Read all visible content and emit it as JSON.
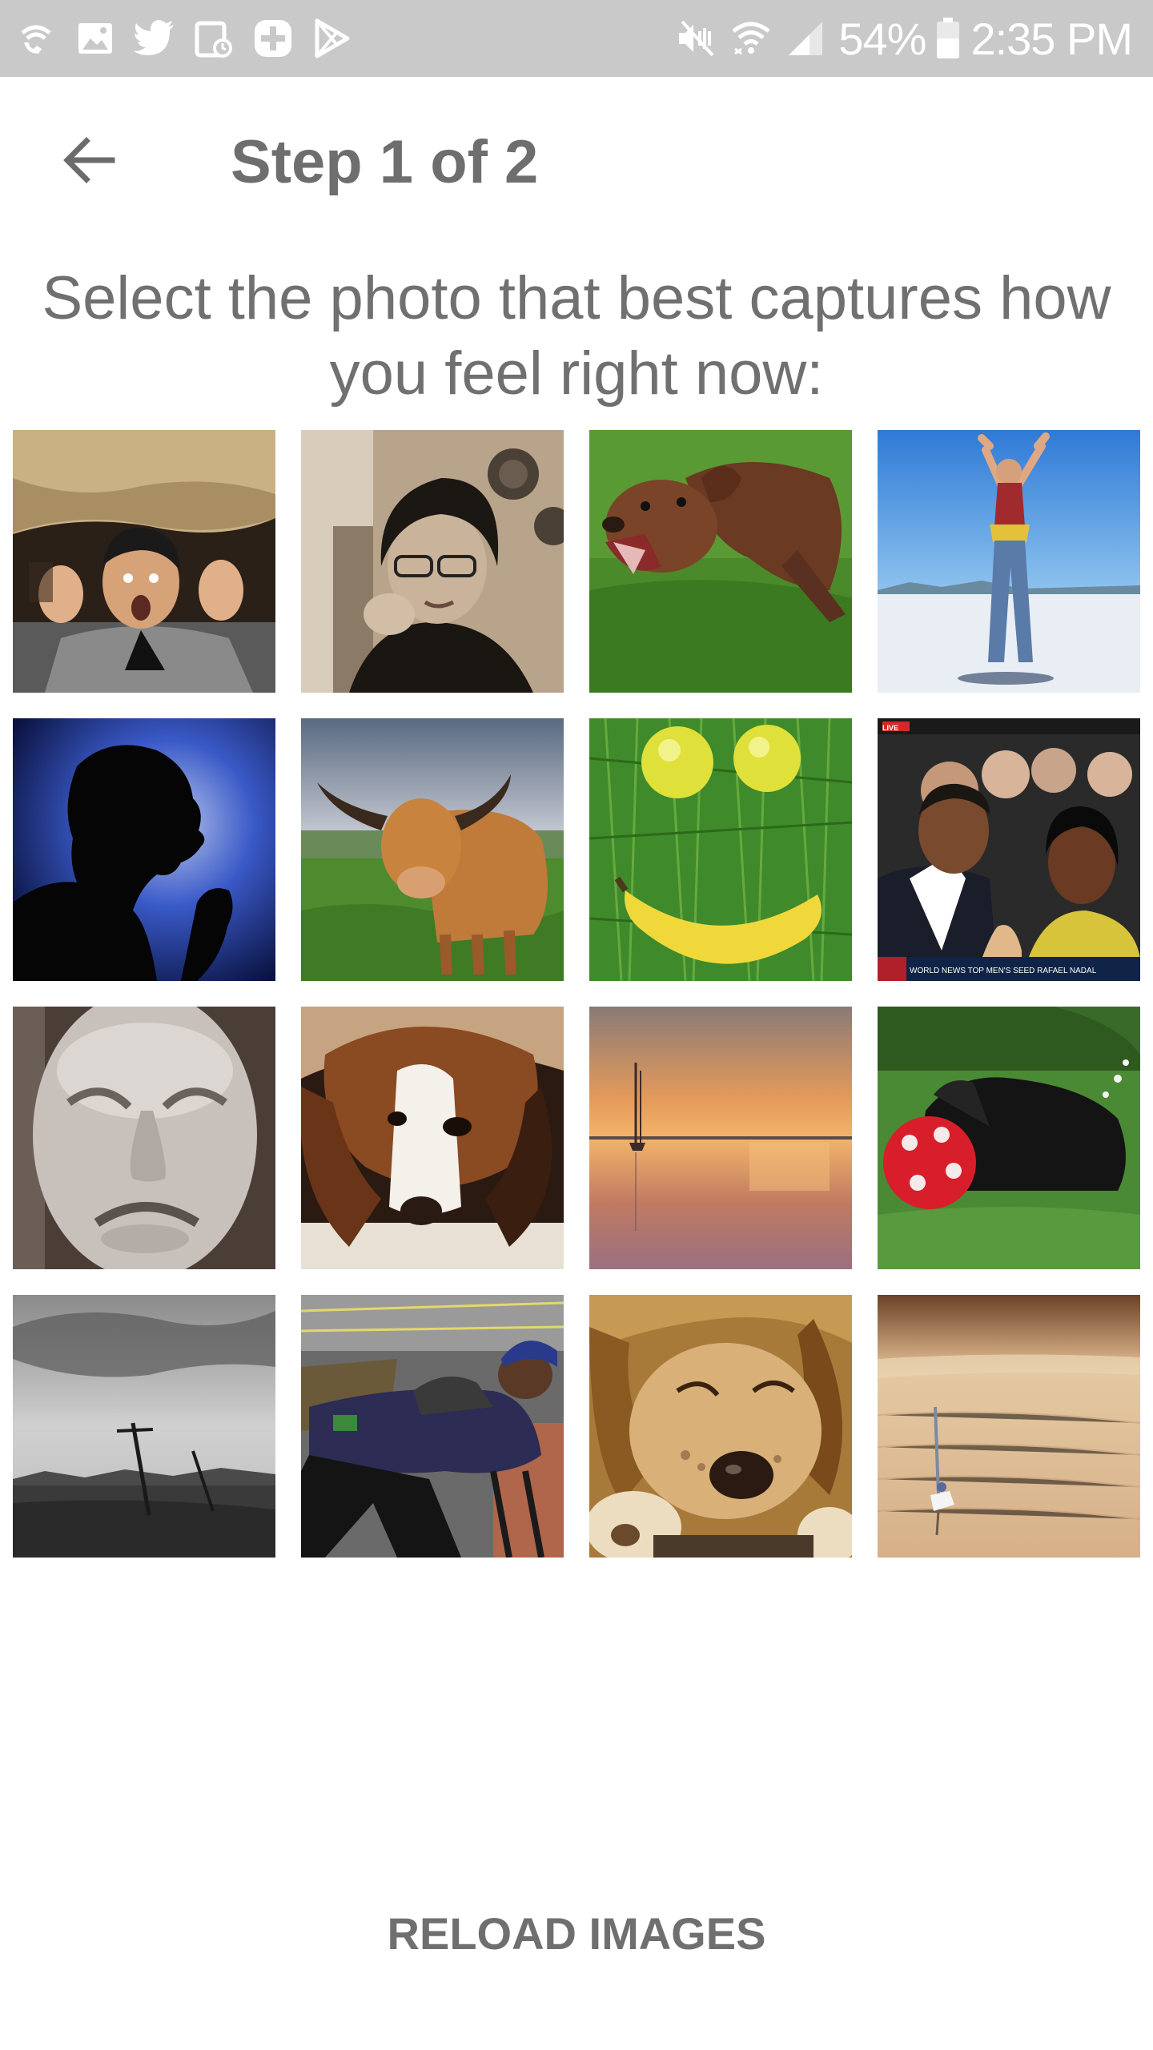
{
  "status_bar": {
    "battery": "54%",
    "time": "2:35 PM",
    "left_icons": [
      "wifi-call-icon",
      "image-icon",
      "twitter-icon",
      "calendar-icon",
      "plus-icon",
      "play-store-icon"
    ],
    "right_icons": [
      "mute-vibrate-icon",
      "wifi-icon",
      "signal-icon",
      "battery-icon"
    ]
  },
  "app_bar": {
    "back_icon": "arrow-left-icon",
    "title": "Step 1 of 2"
  },
  "prompt": {
    "line1": "Select the photo that best captures how",
    "line2": "you feel right now:"
  },
  "photos": [
    "surprised-man-cave",
    "nervous-woman-glasses",
    "running-dog-grass",
    "jumping-woman-salt-flat",
    "silhouette-shouting",
    "highland-cow",
    "fruit-smiley-face",
    "crowd-news-broadcast",
    "sad-mask-face",
    "beagle-lying-down",
    "sunset-boat-water",
    "black-dog-red-ball",
    "grayscale-landscape-poles",
    "man-sleeping-bench",
    "sleeping-golden-dog",
    "desert-figure-sepia"
  ],
  "tv_overlay": {
    "live": "LIVE",
    "ticker": "WORLD NEWS TOP MEN'S SEED RAFAEL NADAL"
  },
  "actions": {
    "reload_label": "RELOAD IMAGES"
  }
}
